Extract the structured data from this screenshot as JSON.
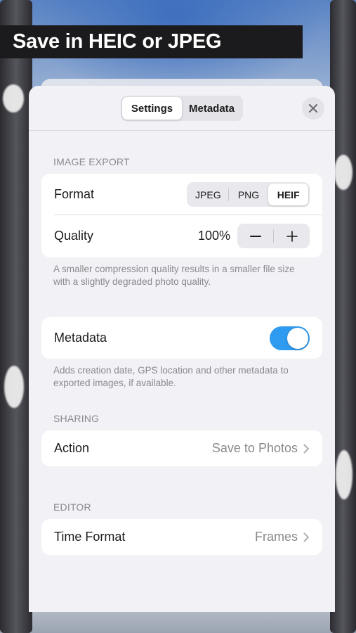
{
  "banner": {
    "title": "Save in HEIC or JPEG"
  },
  "header": {
    "tabs": [
      {
        "label": "Settings",
        "active": true
      },
      {
        "label": "Metadata",
        "active": false
      }
    ],
    "close_icon": "close-icon"
  },
  "image_export": {
    "section_label": "IMAGE EXPORT",
    "format": {
      "label": "Format",
      "options": [
        "JPEG",
        "PNG",
        "HEIF"
      ],
      "selected": "HEIF"
    },
    "quality": {
      "label": "Quality",
      "value": "100%",
      "decrement_icon": "minus-icon",
      "increment_icon": "plus-icon"
    },
    "footnote": "A smaller compression quality results in a smaller file size with a slightly degraded photo quality."
  },
  "metadata": {
    "label": "Metadata",
    "enabled": true,
    "footnote": "Adds creation date, GPS location and other metadata to exported images, if available."
  },
  "sharing": {
    "section_label": "SHARING",
    "action": {
      "label": "Action",
      "value": "Save to Photos"
    }
  },
  "editor": {
    "section_label": "EDITOR",
    "time_format": {
      "label": "Time Format",
      "value": "Frames"
    }
  },
  "colors": {
    "accent": "#2f9bf0",
    "banner_bg": "#1b1b1d",
    "sheet_bg": "#f2f2f6",
    "secondary_text": "#8a8a8e"
  }
}
